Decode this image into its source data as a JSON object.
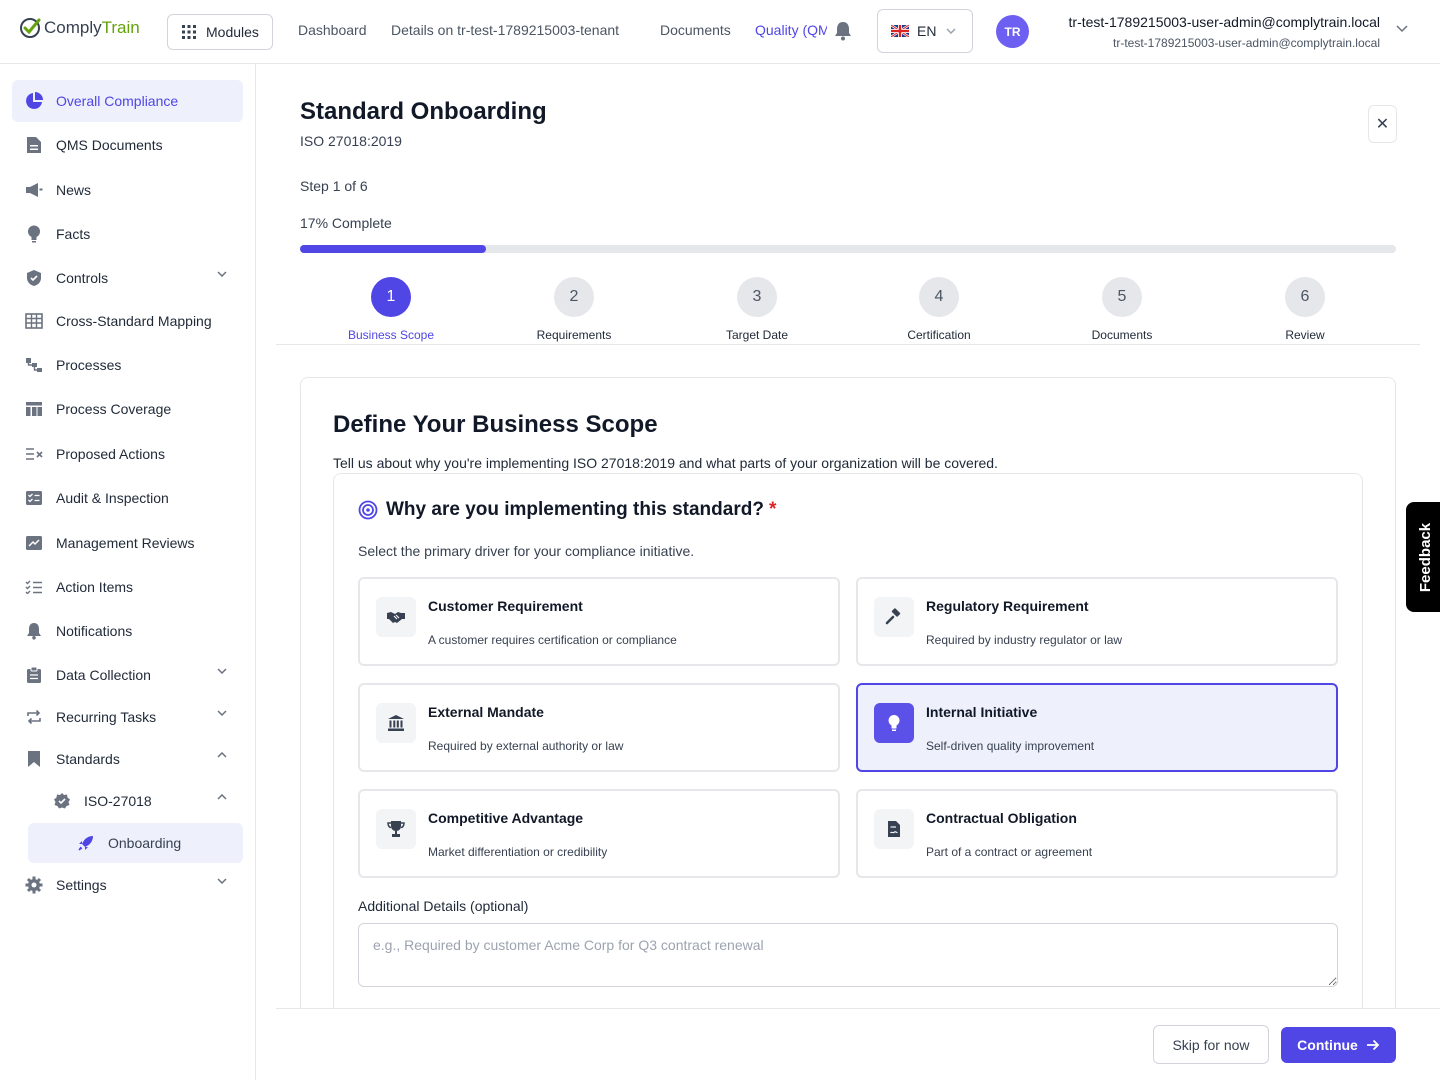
{
  "header": {
    "logo_comply": "Comply",
    "logo_train": "Train",
    "modules_label": "Modules",
    "nav": [
      "Dashboard",
      "Details on tr-test-1789215003-tenant",
      "Documents",
      "Quality (QMS)"
    ],
    "language": "EN",
    "avatar_initials": "TR",
    "user_name": "tr-test-1789215003-user-admin@complytrain.local",
    "user_email": "tr-test-1789215003-user-admin@complytrain.local"
  },
  "sidebar": {
    "items": [
      {
        "label": "Overall Compliance",
        "icon": "pie-chart-icon",
        "active": true
      },
      {
        "label": "QMS Documents",
        "icon": "document-icon"
      },
      {
        "label": "News",
        "icon": "megaphone-icon"
      },
      {
        "label": "Facts",
        "icon": "lightbulb-icon"
      },
      {
        "label": "Controls",
        "icon": "shield-icon",
        "expandable": true
      },
      {
        "label": "Cross-Standard Mapping",
        "icon": "table-icon"
      },
      {
        "label": "Processes",
        "icon": "flow-icon"
      },
      {
        "label": "Process Coverage",
        "icon": "grid-table-icon"
      },
      {
        "label": "Proposed Actions",
        "icon": "list-x-icon"
      },
      {
        "label": "Audit & Inspection",
        "icon": "checklist-icon"
      },
      {
        "label": "Management Reviews",
        "icon": "chart-board-icon"
      },
      {
        "label": "Action Items",
        "icon": "check-list-icon"
      },
      {
        "label": "Notifications",
        "icon": "bell-icon"
      },
      {
        "label": "Data Collection",
        "icon": "clipboard-icon",
        "expandable": true
      },
      {
        "label": "Recurring Tasks",
        "icon": "repeat-icon",
        "expandable": true
      },
      {
        "label": "Standards",
        "icon": "bookmark-icon",
        "expanded": true
      },
      {
        "label": "ISO-27018",
        "icon": "badge-check-icon",
        "expanded": true
      },
      {
        "label": "Onboarding",
        "icon": "rocket-icon"
      },
      {
        "label": "Settings",
        "icon": "gear-icon",
        "expandable": true
      }
    ]
  },
  "main": {
    "title": "Standard Onboarding",
    "subtitle": "ISO 27018:2019",
    "step_text": "Step 1 of 6",
    "percent_text": "17% Complete",
    "progress": 0.17,
    "steps": [
      {
        "num": "1",
        "label": "Business Scope"
      },
      {
        "num": "2",
        "label": "Requirements"
      },
      {
        "num": "3",
        "label": "Target Date"
      },
      {
        "num": "4",
        "label": "Certification"
      },
      {
        "num": "5",
        "label": "Documents"
      },
      {
        "num": "6",
        "label": "Review"
      }
    ],
    "section_title": "Define Your Business Scope",
    "section_desc": "Tell us about why you're implementing ISO 27018:2019 and what parts of your organization will be covered.",
    "question": "Why are you implementing this standard?",
    "required_mark": "*",
    "question_desc": "Select the primary driver for your compliance initiative.",
    "options": [
      {
        "title": "Customer Requirement",
        "desc": "A customer requires certification or compliance",
        "icon": "handshake-icon"
      },
      {
        "title": "Regulatory Requirement",
        "desc": "Required by industry regulator or law",
        "icon": "gavel-icon"
      },
      {
        "title": "External Mandate",
        "desc": "Required by external authority or law",
        "icon": "building-columns-icon"
      },
      {
        "title": "Internal Initiative",
        "desc": "Self-driven quality improvement",
        "icon": "lightbulb-icon",
        "selected": true
      },
      {
        "title": "Competitive Advantage",
        "desc": "Market differentiation or credibility",
        "icon": "trophy-icon"
      },
      {
        "title": "Contractual Obligation",
        "desc": "Part of a contract or agreement",
        "icon": "contract-icon"
      }
    ],
    "additional_label": "Additional Details (optional)",
    "additional_placeholder": "e.g., Required by customer Acme Corp for Q3 contract renewal",
    "additional_value": "",
    "skip_label": "Skip for now",
    "continue_label": "Continue",
    "feedback_label": "Feedback",
    "close_glyph": "✕"
  },
  "colors": {
    "accent": "#4f46e5",
    "brand_green": "#65a30d",
    "selected_bg": "#eef0fb",
    "required": "#dc2626"
  }
}
